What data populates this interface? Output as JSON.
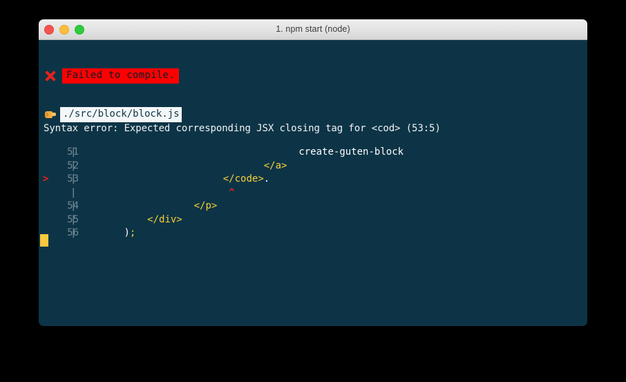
{
  "window": {
    "title": "1. npm start (node)",
    "traffic_lights": [
      {
        "name": "close-button",
        "color": "#f3544f"
      },
      {
        "name": "minimize-button",
        "color": "#fbbd3c"
      },
      {
        "name": "maximize-button",
        "color": "#2dcb3f"
      }
    ]
  },
  "terminal": {
    "background_color": "#0d3446",
    "error_icon": "x-mark-icon",
    "failed_badge": "Failed to compile.",
    "failed_badge_bg": "#fe0000",
    "pointer_icon": "pointing-finger-icon",
    "file_path": "./src/block/block.js",
    "file_path_bg": "#f4f7f8",
    "syntax_error": "Syntax error: Expected corresponding JSX closing tag for <cod> (53:5)",
    "cursor_color": "#fbc93d",
    "code_lines": [
      {
        "marker": "",
        "number": "51",
        "pipe": "|",
        "indent_ch": 38,
        "text": "create-guten-block",
        "style": "white"
      },
      {
        "marker": "",
        "number": "52",
        "pipe": "|",
        "indent_ch": 32,
        "text": "</a>",
        "style": "tag"
      },
      {
        "marker": ">",
        "number": "53",
        "pipe": "|",
        "indent_ch": 25,
        "text": "</code>",
        "trailing": ".",
        "style": "tag"
      },
      {
        "marker": "",
        "number": "",
        "pipe": "|",
        "indent_ch": 25,
        "caret": "^",
        "caret_offset_ch": 1,
        "text": "",
        "style": "caret"
      },
      {
        "marker": "",
        "number": "54",
        "pipe": "|",
        "indent_ch": 20,
        "text": "</p>",
        "style": "tag"
      },
      {
        "marker": "",
        "number": "55",
        "pipe": "|",
        "indent_ch": 12,
        "text": "</div>",
        "style": "tag"
      },
      {
        "marker": "",
        "number": "56",
        "pipe": "|",
        "indent_ch": 8,
        "text": ")",
        "trailing": ";",
        "style": "white-paren"
      }
    ]
  }
}
